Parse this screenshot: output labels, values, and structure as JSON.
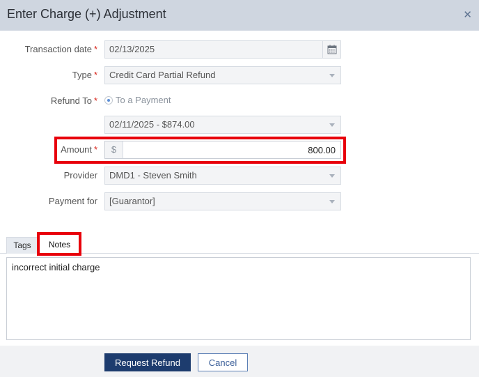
{
  "dialog": {
    "title": "Enter Charge (+) Adjustment",
    "close_icon": "close-icon"
  },
  "form": {
    "transaction_date": {
      "label": "Transaction date",
      "required": "*",
      "value": "02/13/2025",
      "icon": "calendar-icon"
    },
    "type": {
      "label": "Type",
      "required": "*",
      "value": "Credit Card Partial Refund"
    },
    "refund_to": {
      "label": "Refund To",
      "required": "*",
      "option": "To a Payment",
      "payment_value": "02/11/2025 - $874.00"
    },
    "amount": {
      "label": "Amount",
      "required": "*",
      "currency": "$",
      "value": "800.00"
    },
    "provider": {
      "label": "Provider",
      "value": "DMD1 - Steven Smith"
    },
    "payment_for": {
      "label": "Payment for",
      "value": "[Guarantor]"
    }
  },
  "tabs": [
    {
      "label": "Tags"
    },
    {
      "label": "Notes"
    }
  ],
  "notes": {
    "text": "incorrect initial charge"
  },
  "footer": {
    "request_refund_label": "Request Refund",
    "cancel_label": "Cancel"
  },
  "colors": {
    "highlight": "#e8000b",
    "primary": "#1d3c6e",
    "required": "#d9261c"
  }
}
